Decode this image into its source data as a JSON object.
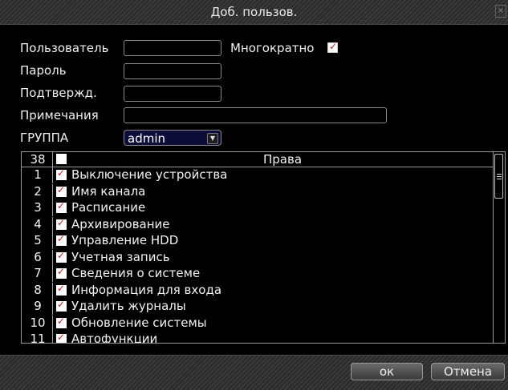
{
  "dialog": {
    "title": "Доб. пользов.",
    "close_glyph": "×"
  },
  "form": {
    "user_label": "Пользователь",
    "user_value": "",
    "password_label": "Пароль",
    "password_value": "",
    "confirm_label": "Подтвержд.",
    "confirm_value": "",
    "notes_label": "Примечания",
    "notes_value": "",
    "group_label": "ГРУППА",
    "group_value": "admin",
    "multi_label": "Многократно",
    "multi_checked": true
  },
  "rights": {
    "count": "38",
    "header": "Права",
    "items": [
      {
        "num": "1",
        "label": "Выключение устройства"
      },
      {
        "num": "2",
        "label": "Имя канала"
      },
      {
        "num": "3",
        "label": "Расписание"
      },
      {
        "num": "4",
        "label": "Архивирование"
      },
      {
        "num": "5",
        "label": "Управление HDD"
      },
      {
        "num": "6",
        "label": "Учетная запись"
      },
      {
        "num": "7",
        "label": "Сведения о системе"
      },
      {
        "num": "8",
        "label": "Информация для входа"
      },
      {
        "num": "9",
        "label": "Удалить журналы"
      },
      {
        "num": "10",
        "label": "Обновление системы"
      },
      {
        "num": "11",
        "label": "Автофункции"
      }
    ]
  },
  "buttons": {
    "ok": "ок",
    "cancel": "Отмена"
  },
  "colors": {
    "check_mark": "#d21f1f",
    "select_bg": "#0d0d3a"
  }
}
